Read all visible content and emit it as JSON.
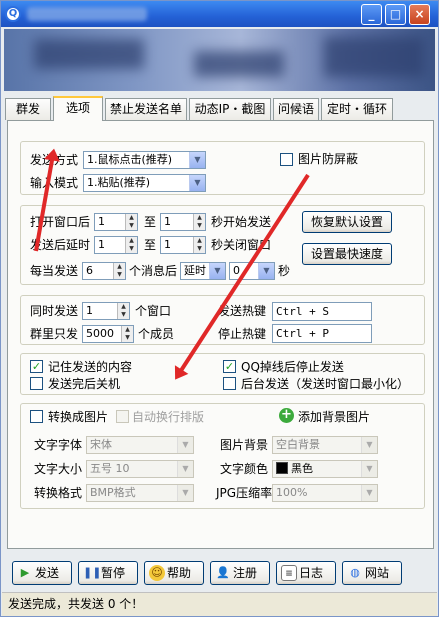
{
  "window": {
    "icon_label": "Q",
    "minimize": "_",
    "maximize": "□",
    "close": "×"
  },
  "tabs": [
    "群发",
    "选项",
    "禁止发送名单",
    "动态IP・截图",
    "问候语",
    "定时・循环"
  ],
  "send_method": {
    "send_label": "发送方式",
    "send_value": "1.鼠标点击(推荐)",
    "input_label": "输入模式",
    "input_value": "1.粘贴(推荐)",
    "anti_screen_label": "图片防屏蔽"
  },
  "timing": {
    "open_label": "打开窗口后",
    "open_from": "1",
    "to1": "至",
    "open_to": "1",
    "open_suffix": "秒开始发送",
    "delay_label": "发送后延时",
    "delay_from": "1",
    "to2": "至",
    "delay_to": "1",
    "delay_suffix": "秒关闭窗口",
    "every_label": "每当发送",
    "every_value": "6",
    "after_label": "个消息后",
    "pause_mode": "延时",
    "pause_value": "0",
    "seconds": "秒",
    "restore_btn": "恢复默认设置",
    "fastest_btn": "设置最快速度"
  },
  "concurrency": {
    "simul_label": "同时发送",
    "simul_value": "1",
    "simul_unit": "个窗口",
    "group_label": "群里只发",
    "group_value": "5000",
    "group_unit": "个成员",
    "send_hotkey_label": "发送热键",
    "send_hotkey": "Ctrl + S",
    "stop_hotkey_label": "停止热键",
    "stop_hotkey": "Ctrl + P"
  },
  "options": {
    "remember": "记住发送的内容",
    "shutdown": "发送完后关机",
    "qq_offline": "QQ掉线后停止发送",
    "background": "后台发送（发送时窗口最小化）"
  },
  "image_conv": {
    "convert_label": "转换成图片",
    "autowrap_label": "自动换行排版",
    "add_bg": "添加背景图片",
    "font_label": "文字字体",
    "font_value": "宋体",
    "size_label": "文字大小",
    "size_value": "五号 10",
    "format_label": "转换格式",
    "format_value": "BMP格式",
    "bg_label": "图片背景",
    "bg_value": "空白背景",
    "color_label": "文字颜色",
    "color_value": "黑色",
    "color_hex": "#000000",
    "jpg_label": "JPG压缩率",
    "jpg_value": "100%"
  },
  "bottom": {
    "send": "发送",
    "pause": "暂停",
    "help": "帮助",
    "register": "注册",
    "log": "日志",
    "site": "网站"
  },
  "status": "发送完成，共发送 0 个！",
  "colors": {
    "arrow": "#e02828",
    "titlebar": "#2461d6",
    "tab_highlight": "#ffc83c"
  }
}
